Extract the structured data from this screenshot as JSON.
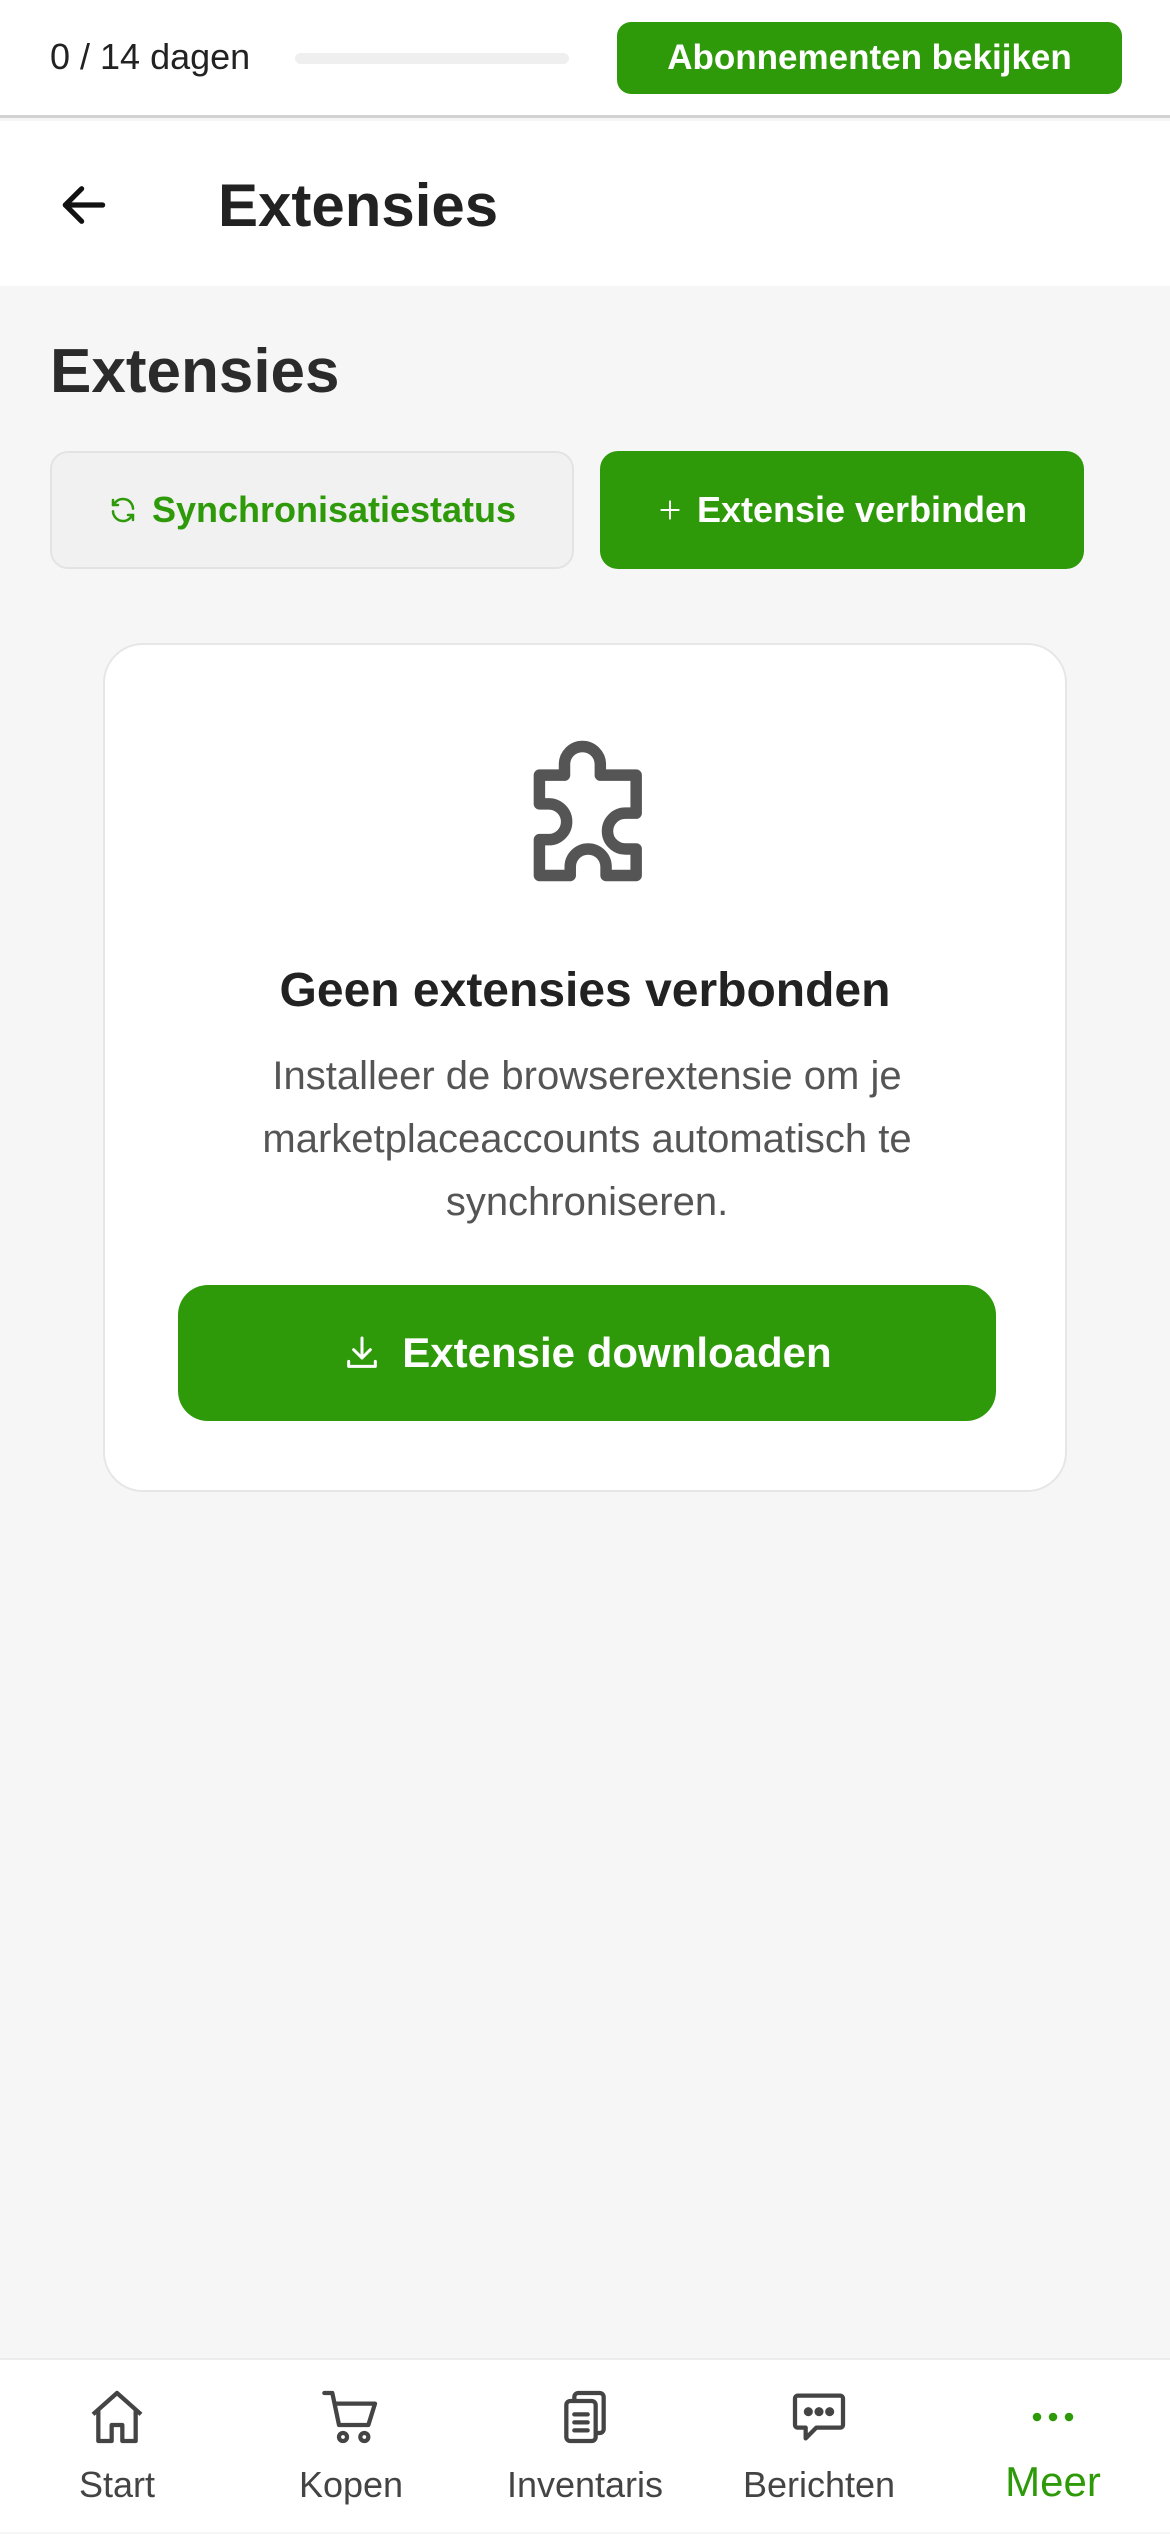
{
  "trial": {
    "days_text": "0 / 14 dagen",
    "progress_fraction": 0,
    "subscribe_label": "Abonnementen bekijken"
  },
  "header": {
    "title": "Extensies",
    "back_icon": "arrow-left-icon"
  },
  "main": {
    "heading": "Extensies",
    "sync_button_label": "Synchronisatiestatus",
    "sync_icon": "refresh-icon",
    "connect_button_label": "Extensie verbinden",
    "connect_icon": "plus-icon"
  },
  "empty_state": {
    "icon": "puzzle-icon",
    "title": "Geen extensies verbonden",
    "description": "Installeer de browserextensie om je marketplaceaccounts automatisch te synchroniseren.",
    "download_label": "Extensie downloaden",
    "download_icon": "download-icon"
  },
  "bottom_nav": {
    "items": [
      {
        "label": "Start",
        "icon": "home-icon"
      },
      {
        "label": "Kopen",
        "icon": "cart-icon"
      },
      {
        "label": "Inventaris",
        "icon": "clipboard-icon"
      },
      {
        "label": "Berichten",
        "icon": "chat-icon"
      },
      {
        "label": "Meer",
        "icon": "more-icon",
        "active": true
      }
    ]
  },
  "colors": {
    "accent": "#2e9a0a",
    "background": "#f6f6f6",
    "card": "#ffffff"
  }
}
